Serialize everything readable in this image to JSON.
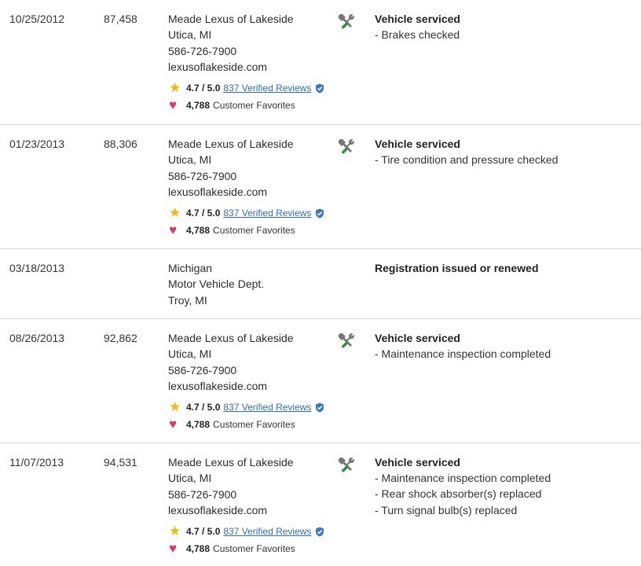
{
  "records": [
    {
      "date": "10/25/2012",
      "mileage": "87,458",
      "source": [
        "Meade Lexus of Lakeside",
        "Utica, MI",
        "586-726-7900",
        "lexusoflakeside.com"
      ],
      "rating": "4.7 / 5.0",
      "reviews": "837 Verified Reviews",
      "favorites_count": "4,788",
      "favorites_label": "Customer Favorites",
      "icon": "service-tools-icon",
      "title": "Vehicle serviced",
      "details": [
        "- Brakes checked"
      ]
    },
    {
      "date": "01/23/2013",
      "mileage": "88,306",
      "source": [
        "Meade Lexus of Lakeside",
        "Utica, MI",
        "586-726-7900",
        "lexusoflakeside.com"
      ],
      "rating": "4.7 / 5.0",
      "reviews": "837 Verified Reviews",
      "favorites_count": "4,788",
      "favorites_label": "Customer Favorites",
      "icon": "service-tools-icon",
      "title": "Vehicle serviced",
      "details": [
        "- Tire condition and pressure checked"
      ]
    },
    {
      "date": "03/18/2013",
      "mileage": "",
      "source": [
        "Michigan",
        "Motor Vehicle Dept.",
        "Troy, MI"
      ],
      "title": "Registration issued or renewed",
      "details": []
    },
    {
      "date": "08/26/2013",
      "mileage": "92,862",
      "source": [
        "Meade Lexus of Lakeside",
        "Utica, MI",
        "586-726-7900",
        "lexusoflakeside.com"
      ],
      "rating": "4.7 / 5.0",
      "reviews": "837 Verified Reviews",
      "favorites_count": "4,788",
      "favorites_label": "Customer Favorites",
      "icon": "service-tools-icon",
      "title": "Vehicle serviced",
      "details": [
        "- Maintenance inspection completed"
      ]
    },
    {
      "date": "11/07/2013",
      "mileage": "94,531",
      "source": [
        "Meade Lexus of Lakeside",
        "Utica, MI",
        "586-726-7900",
        "lexusoflakeside.com"
      ],
      "rating": "4.7 / 5.0",
      "reviews": "837 Verified Reviews",
      "favorites_count": "4,788",
      "favorites_label": "Customer Favorites",
      "icon": "service-tools-icon",
      "title": "Vehicle serviced",
      "details": [
        "- Maintenance inspection completed",
        "- Rear shock absorber(s) replaced",
        "- Turn signal bulb(s) replaced"
      ]
    }
  ],
  "colors": {
    "star": "#f2b705",
    "heart": "#e0356f",
    "link": "#2e6fb4",
    "verified_badge": "#3a78c3",
    "divider": "#d9d9d9",
    "wrench_handle": "#2f8f3a",
    "tool_gray": "#777777"
  }
}
